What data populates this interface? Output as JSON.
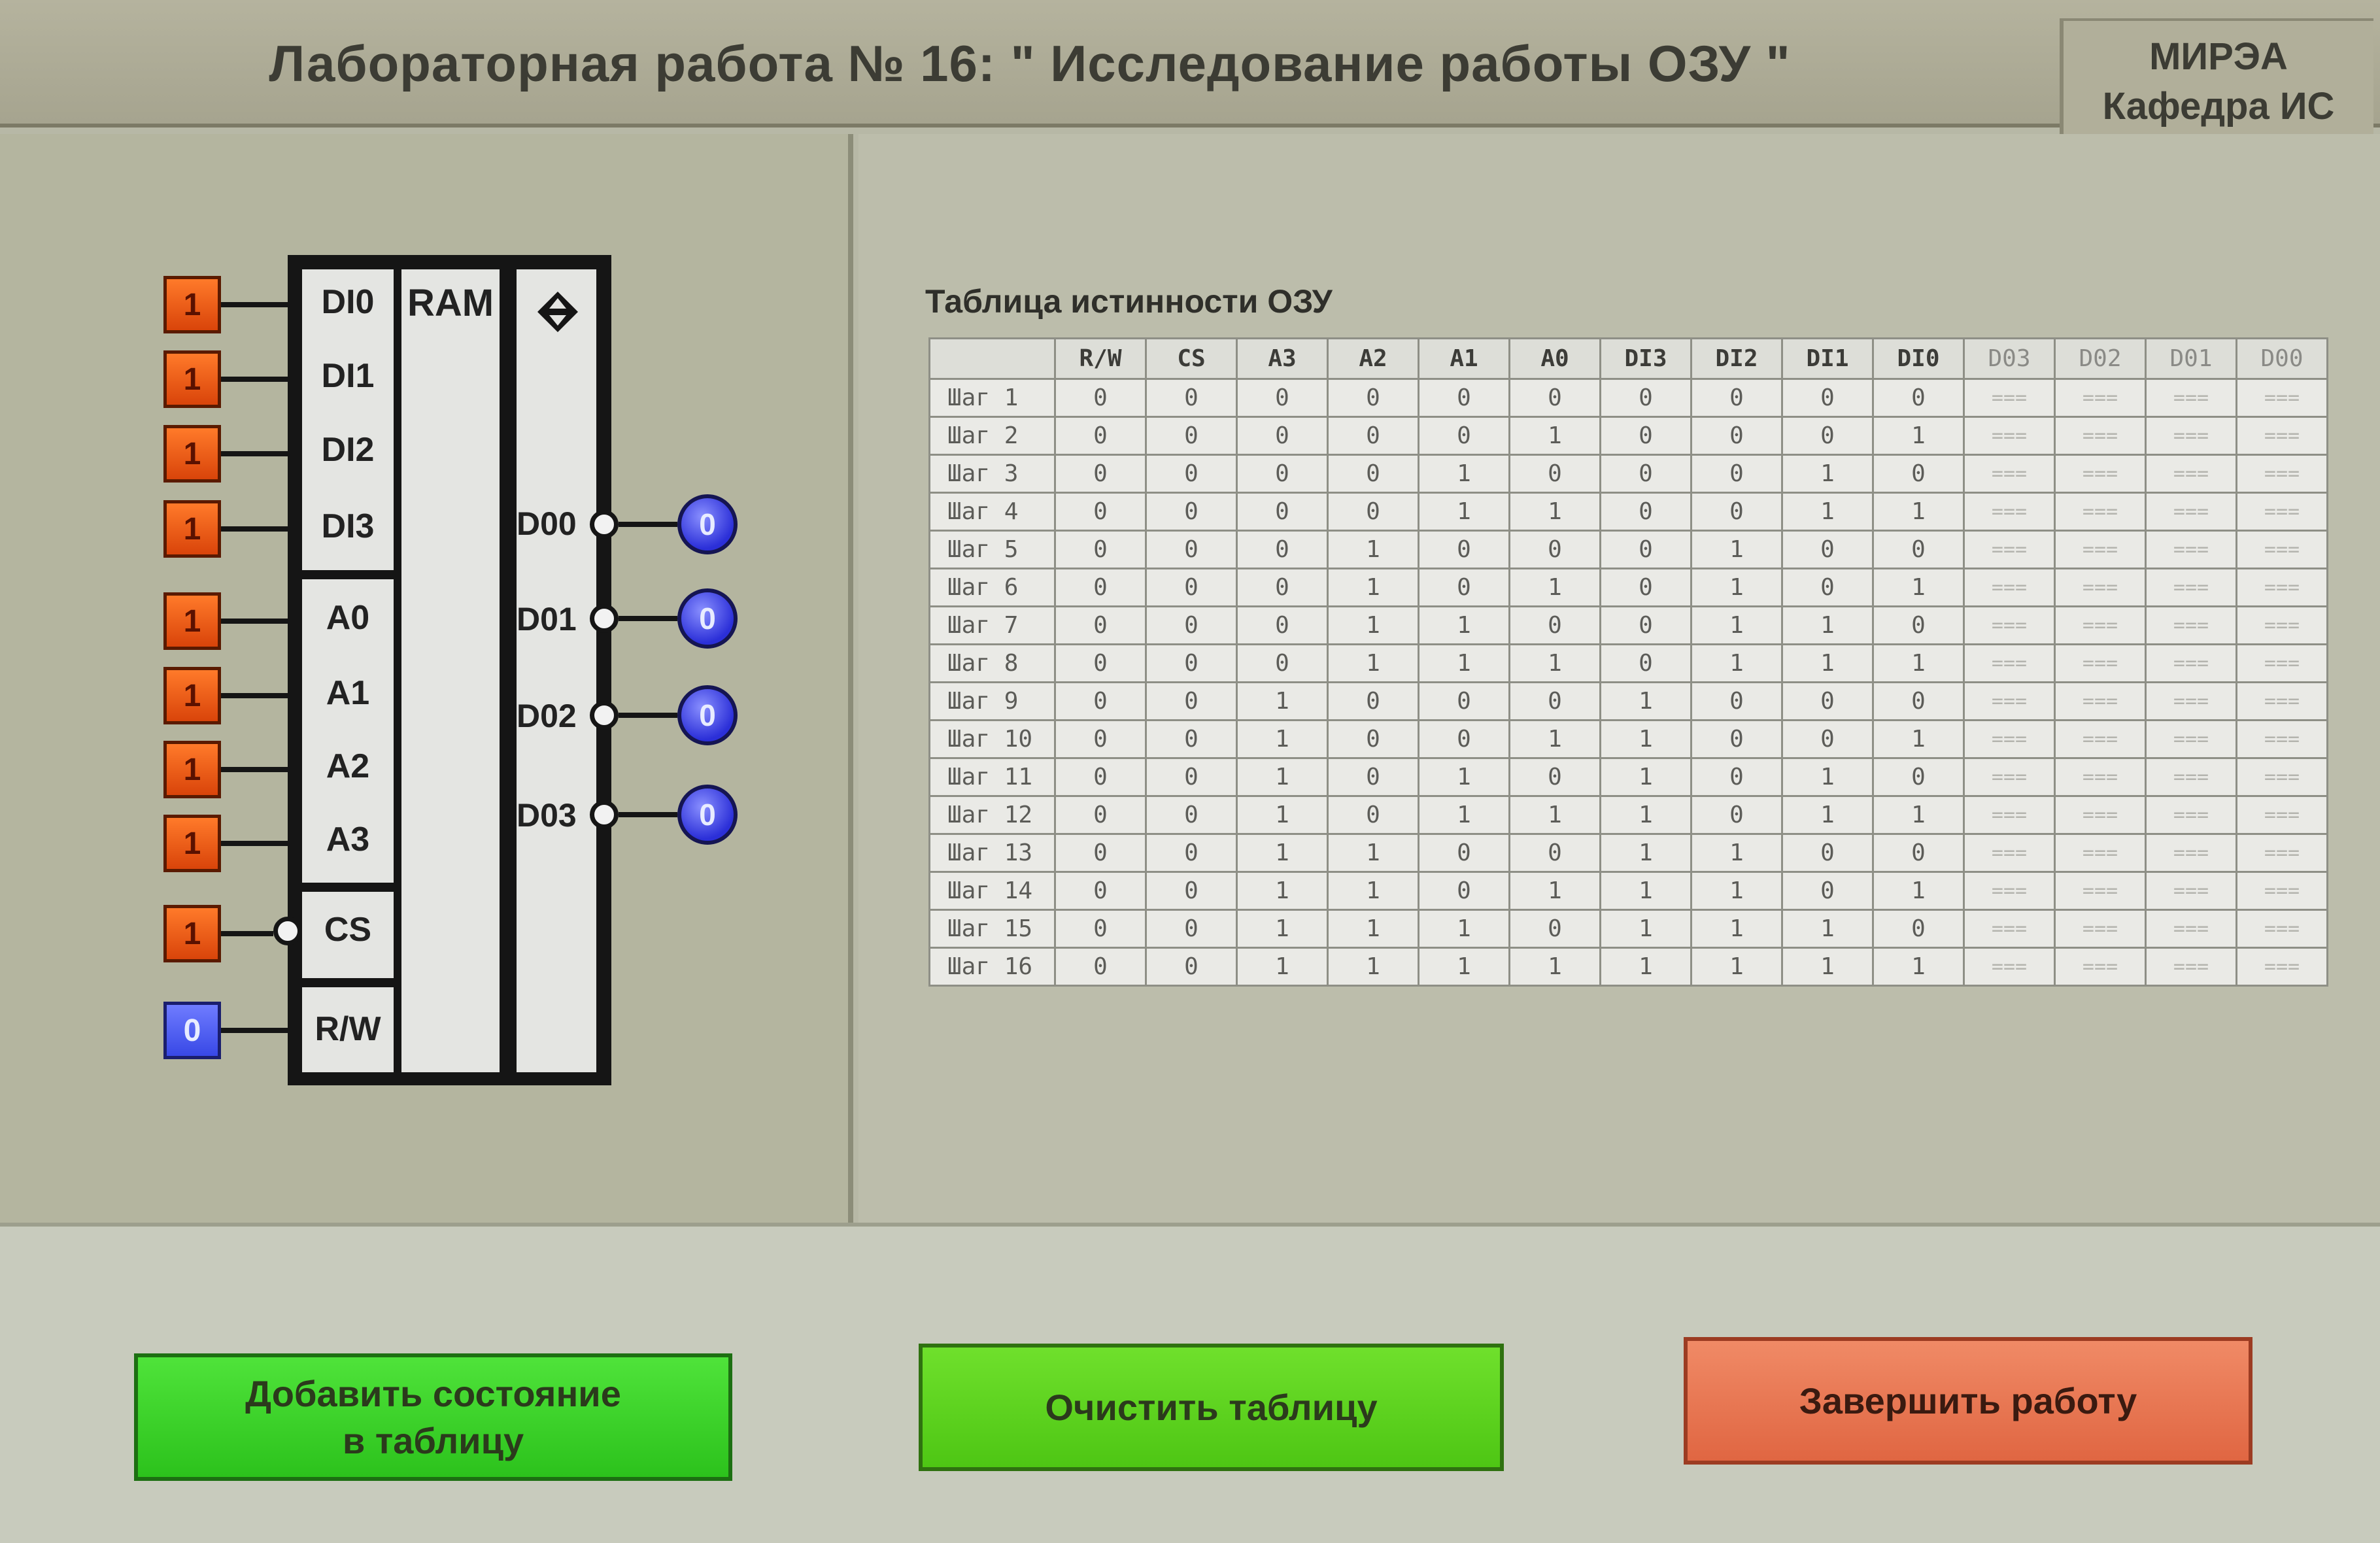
{
  "header": {
    "title": "Лабораторная работа № 16: \" Исследование работы ОЗУ \"",
    "org_line1": "МИРЭА",
    "org_line2": "Кафедра ИС"
  },
  "chip": {
    "ram_label": "RAM",
    "inputs": [
      {
        "label": "DI0",
        "value": "1"
      },
      {
        "label": "DI1",
        "value": "1"
      },
      {
        "label": "DI2",
        "value": "1"
      },
      {
        "label": "DI3",
        "value": "1"
      },
      {
        "label": "A0",
        "value": "1"
      },
      {
        "label": "A1",
        "value": "1"
      },
      {
        "label": "A2",
        "value": "1"
      },
      {
        "label": "A3",
        "value": "1"
      },
      {
        "label": "CS",
        "value": "1"
      },
      {
        "label": "R/W",
        "value": "0"
      }
    ],
    "outputs": [
      {
        "label": "D00",
        "value": "0"
      },
      {
        "label": "D01",
        "value": "0"
      },
      {
        "label": "D02",
        "value": "0"
      },
      {
        "label": "D03",
        "value": "0"
      }
    ]
  },
  "table": {
    "title": "Таблица истинности ОЗУ",
    "columns": [
      "R/W",
      "CS",
      "A3",
      "A2",
      "A1",
      "A0",
      "DI3",
      "DI2",
      "DI1",
      "DI0",
      "D03",
      "D02",
      "D01",
      "D00"
    ],
    "rows": [
      {
        "label": "Шаг 1",
        "values": [
          "0",
          "0",
          "0",
          "0",
          "0",
          "0",
          "0",
          "0",
          "0",
          "0",
          "===",
          "===",
          "===",
          "==="
        ]
      },
      {
        "label": "Шаг 2",
        "values": [
          "0",
          "0",
          "0",
          "0",
          "0",
          "1",
          "0",
          "0",
          "0",
          "1",
          "===",
          "===",
          "===",
          "==="
        ]
      },
      {
        "label": "Шаг 3",
        "values": [
          "0",
          "0",
          "0",
          "0",
          "1",
          "0",
          "0",
          "0",
          "1",
          "0",
          "===",
          "===",
          "===",
          "==="
        ]
      },
      {
        "label": "Шаг 4",
        "values": [
          "0",
          "0",
          "0",
          "0",
          "1",
          "1",
          "0",
          "0",
          "1",
          "1",
          "===",
          "===",
          "===",
          "==="
        ]
      },
      {
        "label": "Шаг 5",
        "values": [
          "0",
          "0",
          "0",
          "1",
          "0",
          "0",
          "0",
          "1",
          "0",
          "0",
          "===",
          "===",
          "===",
          "==="
        ]
      },
      {
        "label": "Шаг 6",
        "values": [
          "0",
          "0",
          "0",
          "1",
          "0",
          "1",
          "0",
          "1",
          "0",
          "1",
          "===",
          "===",
          "===",
          "==="
        ]
      },
      {
        "label": "Шаг 7",
        "values": [
          "0",
          "0",
          "0",
          "1",
          "1",
          "0",
          "0",
          "1",
          "1",
          "0",
          "===",
          "===",
          "===",
          "==="
        ]
      },
      {
        "label": "Шаг 8",
        "values": [
          "0",
          "0",
          "0",
          "1",
          "1",
          "1",
          "0",
          "1",
          "1",
          "1",
          "===",
          "===",
          "===",
          "==="
        ]
      },
      {
        "label": "Шаг 9",
        "values": [
          "0",
          "0",
          "1",
          "0",
          "0",
          "0",
          "1",
          "0",
          "0",
          "0",
          "===",
          "===",
          "===",
          "==="
        ]
      },
      {
        "label": "Шаг 10",
        "values": [
          "0",
          "0",
          "1",
          "0",
          "0",
          "1",
          "1",
          "0",
          "0",
          "1",
          "===",
          "===",
          "===",
          "==="
        ]
      },
      {
        "label": "Шаг 11",
        "values": [
          "0",
          "0",
          "1",
          "0",
          "1",
          "0",
          "1",
          "0",
          "1",
          "0",
          "===",
          "===",
          "===",
          "==="
        ]
      },
      {
        "label": "Шаг 12",
        "values": [
          "0",
          "0",
          "1",
          "0",
          "1",
          "1",
          "1",
          "0",
          "1",
          "1",
          "===",
          "===",
          "===",
          "==="
        ]
      },
      {
        "label": "Шаг 13",
        "values": [
          "0",
          "0",
          "1",
          "1",
          "0",
          "0",
          "1",
          "1",
          "0",
          "0",
          "===",
          "===",
          "===",
          "==="
        ]
      },
      {
        "label": "Шаг 14",
        "values": [
          "0",
          "0",
          "1",
          "1",
          "0",
          "1",
          "1",
          "1",
          "0",
          "1",
          "===",
          "===",
          "===",
          "==="
        ]
      },
      {
        "label": "Шаг 15",
        "values": [
          "0",
          "0",
          "1",
          "1",
          "1",
          "0",
          "1",
          "1",
          "1",
          "0",
          "===",
          "===",
          "===",
          "==="
        ]
      },
      {
        "label": "Шаг 16",
        "values": [
          "0",
          "0",
          "1",
          "1",
          "1",
          "1",
          "1",
          "1",
          "1",
          "1",
          "===",
          "===",
          "===",
          "==="
        ]
      }
    ]
  },
  "buttons": {
    "add_line1": "Добавить состояние",
    "add_line2": "в таблицу",
    "clear": "Очистить таблицу",
    "finish": "Завершить работу"
  }
}
